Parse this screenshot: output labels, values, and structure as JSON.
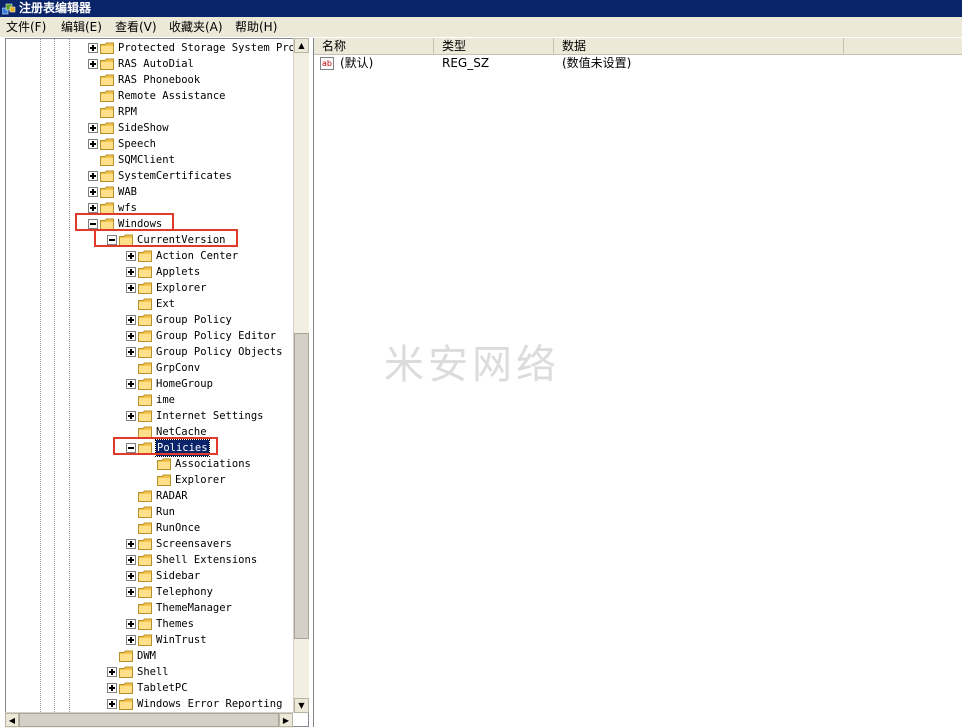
{
  "window": {
    "title": "注册表编辑器",
    "icon": "registry-editor-icon"
  },
  "menu": [
    {
      "label": "文件(F)"
    },
    {
      "label": "编辑(E)"
    },
    {
      "label": "查看(V)"
    },
    {
      "label": "收藏夹(A)"
    },
    {
      "label": "帮助(H)"
    }
  ],
  "tree": {
    "items": [
      {
        "label": "Protected Storage System Pro",
        "depth": 0,
        "expander": "plus",
        "highlighted": false,
        "selected": false
      },
      {
        "label": "RAS AutoDial",
        "depth": 0,
        "expander": "plus",
        "highlighted": false,
        "selected": false
      },
      {
        "label": "RAS Phonebook",
        "depth": 0,
        "expander": "none",
        "highlighted": false,
        "selected": false
      },
      {
        "label": "Remote Assistance",
        "depth": 0,
        "expander": "none",
        "highlighted": false,
        "selected": false
      },
      {
        "label": "RPM",
        "depth": 0,
        "expander": "none",
        "highlighted": false,
        "selected": false
      },
      {
        "label": "SideShow",
        "depth": 0,
        "expander": "plus",
        "highlighted": false,
        "selected": false
      },
      {
        "label": "Speech",
        "depth": 0,
        "expander": "plus",
        "highlighted": false,
        "selected": false
      },
      {
        "label": "SQMClient",
        "depth": 0,
        "expander": "none",
        "highlighted": false,
        "selected": false
      },
      {
        "label": "SystemCertificates",
        "depth": 0,
        "expander": "plus",
        "highlighted": false,
        "selected": false
      },
      {
        "label": "WAB",
        "depth": 0,
        "expander": "plus",
        "highlighted": false,
        "selected": false
      },
      {
        "label": "wfs",
        "depth": 0,
        "expander": "plus",
        "highlighted": false,
        "selected": false
      },
      {
        "label": "Windows",
        "depth": 0,
        "expander": "minus",
        "highlighted": true,
        "selected": false
      },
      {
        "label": "CurrentVersion",
        "depth": 1,
        "expander": "minus",
        "highlighted": true,
        "selected": false
      },
      {
        "label": "Action Center",
        "depth": 2,
        "expander": "plus",
        "highlighted": false,
        "selected": false
      },
      {
        "label": "Applets",
        "depth": 2,
        "expander": "plus",
        "highlighted": false,
        "selected": false
      },
      {
        "label": "Explorer",
        "depth": 2,
        "expander": "plus",
        "highlighted": false,
        "selected": false
      },
      {
        "label": "Ext",
        "depth": 2,
        "expander": "none",
        "highlighted": false,
        "selected": false
      },
      {
        "label": "Group Policy",
        "depth": 2,
        "expander": "plus",
        "highlighted": false,
        "selected": false
      },
      {
        "label": "Group Policy Editor",
        "depth": 2,
        "expander": "plus",
        "highlighted": false,
        "selected": false
      },
      {
        "label": "Group Policy Objects",
        "depth": 2,
        "expander": "plus",
        "highlighted": false,
        "selected": false
      },
      {
        "label": "GrpConv",
        "depth": 2,
        "expander": "none",
        "highlighted": false,
        "selected": false
      },
      {
        "label": "HomeGroup",
        "depth": 2,
        "expander": "plus",
        "highlighted": false,
        "selected": false
      },
      {
        "label": "ime",
        "depth": 2,
        "expander": "none",
        "highlighted": false,
        "selected": false
      },
      {
        "label": "Internet Settings",
        "depth": 2,
        "expander": "plus",
        "highlighted": false,
        "selected": false
      },
      {
        "label": "NetCache",
        "depth": 2,
        "expander": "none",
        "highlighted": false,
        "selected": false
      },
      {
        "label": "Policies",
        "depth": 2,
        "expander": "minus",
        "highlighted": true,
        "selected": true
      },
      {
        "label": "Associations",
        "depth": 3,
        "expander": "none",
        "highlighted": false,
        "selected": false
      },
      {
        "label": "Explorer",
        "depth": 3,
        "expander": "none",
        "highlighted": false,
        "selected": false
      },
      {
        "label": "RADAR",
        "depth": 2,
        "expander": "none",
        "highlighted": false,
        "selected": false
      },
      {
        "label": "Run",
        "depth": 2,
        "expander": "none",
        "highlighted": false,
        "selected": false
      },
      {
        "label": "RunOnce",
        "depth": 2,
        "expander": "none",
        "highlighted": false,
        "selected": false
      },
      {
        "label": "Screensavers",
        "depth": 2,
        "expander": "plus",
        "highlighted": false,
        "selected": false
      },
      {
        "label": "Shell Extensions",
        "depth": 2,
        "expander": "plus",
        "highlighted": false,
        "selected": false
      },
      {
        "label": "Sidebar",
        "depth": 2,
        "expander": "plus",
        "highlighted": false,
        "selected": false
      },
      {
        "label": "Telephony",
        "depth": 2,
        "expander": "plus",
        "highlighted": false,
        "selected": false
      },
      {
        "label": "ThemeManager",
        "depth": 2,
        "expander": "none",
        "highlighted": false,
        "selected": false
      },
      {
        "label": "Themes",
        "depth": 2,
        "expander": "plus",
        "highlighted": false,
        "selected": false
      },
      {
        "label": "WinTrust",
        "depth": 2,
        "expander": "plus",
        "highlighted": false,
        "selected": false
      },
      {
        "label": "DWM",
        "depth": 1,
        "expander": "none",
        "highlighted": false,
        "selected": false
      },
      {
        "label": "Shell",
        "depth": 1,
        "expander": "plus",
        "highlighted": false,
        "selected": false
      },
      {
        "label": "TabletPC",
        "depth": 1,
        "expander": "plus",
        "highlighted": false,
        "selected": false
      },
      {
        "label": "Windows Error Reporting",
        "depth": 1,
        "expander": "plus",
        "highlighted": false,
        "selected": false
      }
    ]
  },
  "list": {
    "columns": [
      "名称",
      "类型",
      "数据"
    ],
    "rows": [
      {
        "name": "(默认)",
        "type": "REG_SZ",
        "data": "(数值未设置)",
        "icon": "string-value-icon"
      }
    ]
  },
  "watermark": "米安网络",
  "colors": {
    "title_bar": "#0a246a",
    "highlight_box": "#e03a2a",
    "selection": "#0a246a",
    "folder": "#f2c34b"
  }
}
